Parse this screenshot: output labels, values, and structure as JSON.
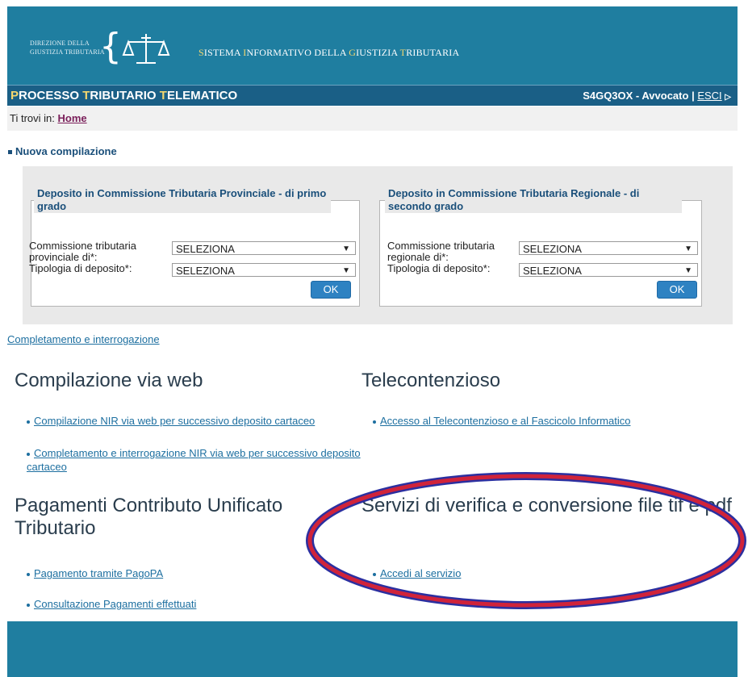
{
  "header": {
    "dir_line1": "DIREZIONE DELLA",
    "dir_line2": "GIUSTIZIA TRIBUTARIA",
    "sys_title_caps": [
      "S",
      "I",
      "G",
      "T"
    ],
    "sys_title_parts": [
      "ISTEMA ",
      "NFORMATIVO DELLA ",
      "IUSTIZIA ",
      "RIBUTARIA"
    ],
    "logo_icon": "scales-icon"
  },
  "topbar": {
    "title_p": "P",
    "title_rest1": "ROCESSO ",
    "title_t": "T",
    "title_rest2": "RIBUTARIO ",
    "title_t2": "T",
    "title_rest3": "ELEMATICO",
    "user": "S4GQ3OX - Avvocato",
    "sep": "|",
    "logout": "ESCI"
  },
  "breadcrumb": {
    "label": "Ti trovi in:",
    "home": "Home"
  },
  "nuova": {
    "title": "Nuova compilazione",
    "left": {
      "legend": "Deposito in Commissione Tributaria Provinciale - di primo grado",
      "label1": "Commissione tributaria provinciale di*:",
      "select1": "SELEZIONA",
      "label2": "Tipologia di deposito*:",
      "select2": "SELEZIONA",
      "ok": "OK"
    },
    "right": {
      "legend": "Deposito in Commissione Tributaria Regionale - di secondo grado",
      "label1": "Commissione tributaria regionale di*:",
      "select1": "SELEZIONA",
      "label2": "Tipologia di deposito*:",
      "select2": "SELEZIONA",
      "ok": "OK"
    }
  },
  "completamento_link": "Completamento e interrogazione",
  "sections": {
    "web": {
      "title": "Compilazione via web",
      "items": [
        "Compilazione NIR via web per successivo deposito cartaceo",
        "Completamento e interrogazione NIR via web per successivo deposito cartaceo"
      ]
    },
    "tele": {
      "title": "Telecontenzioso",
      "items": [
        "Accesso al Telecontenzioso e al Fascicolo Informatico"
      ]
    },
    "pagamenti": {
      "title": "Pagamenti Contributo Unificato Tributario",
      "items": [
        "Pagamento tramite PagoPA",
        "Consultazione Pagamenti effettuati"
      ]
    },
    "servizi": {
      "title": "Servizi di verifica e conversione file tif e pdf",
      "items": [
        "Accedi al servizio"
      ]
    }
  },
  "colors": {
    "banner": "#1f7ea0",
    "topbar": "#1a5f86",
    "accent_caps": "#f5d76e",
    "link": "#1d6fa0",
    "oval_outer": "#2b2fa0",
    "oval_inner": "#d0233a"
  }
}
